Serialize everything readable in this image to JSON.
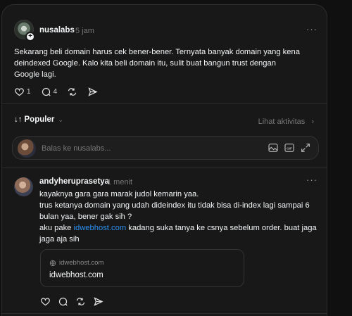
{
  "post": {
    "author": "nusalabs",
    "time": "5 jam",
    "more": "···",
    "text": "Sekarang beli domain harus cek bener-bener. Ternyata banyak domain yang kena deindexed Google. Kalo kita beli domain itu, sulit buat bangun trust dengan Google lagi.",
    "likes": "1",
    "comments": "4",
    "icons": [
      "heart-icon",
      "comment-icon",
      "repost-icon",
      "share-icon"
    ]
  },
  "sort": {
    "arrows": "↓↑",
    "label": "Populer",
    "chevron": "⌄",
    "activity": "Lihat aktivitas",
    "activity_chevron": "›"
  },
  "reply": {
    "placeholder": "Balas ke nusalabs...",
    "icons": [
      "image-icon",
      "gif-icon",
      "expand-icon"
    ]
  },
  "comment": {
    "author": "andyheruprasetya",
    "time": "1 menit",
    "more": "···",
    "line1": "kayaknya gara gara marak judol kemarin yaa.",
    "line2": "trus ketanya domain yang udah dideindex itu tidak bisa di-index lagi sampai 6 bulan yaa, bener gak sih ?",
    "line3_pre": "aku pake ",
    "line3_link": "idwebhost.com",
    "line3_post": " kadang suka tanya ke csnya sebelum order. buat jaga jaga aja sih",
    "link_card": {
      "domain": "idwebhost.com",
      "title": "idwebhost.com"
    }
  },
  "colors": {
    "background": "#101010",
    "card": "#181818",
    "link": "#2a8fef"
  }
}
